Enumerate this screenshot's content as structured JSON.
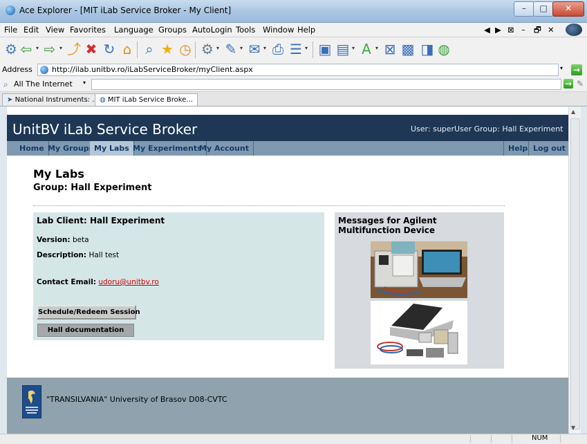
{
  "window": {
    "title": "Ace Explorer - [MIT iLab Service Broker - My Client]",
    "min_symbol": "–",
    "max_symbol": "□",
    "close_symbol": "✕"
  },
  "menu": {
    "items": [
      "File",
      "Edit",
      "View",
      "Favorites",
      "Language",
      "Groups",
      "AutoLogin",
      "Tools",
      "Window",
      "Help"
    ],
    "mdi_controls": [
      "◀",
      "▶",
      "⊠",
      "–",
      "🗗",
      "✕"
    ]
  },
  "address": {
    "label": "Address",
    "url": "http://ilab.unitbv.ro/iLabServiceBroker/myClient.aspx",
    "go_symbol": "→"
  },
  "search": {
    "scope": "All The Internet",
    "dropdown_symbol": "▾"
  },
  "tabs": [
    "National Instruments: ...",
    "MIT iLab Service Broke..."
  ],
  "page": {
    "site_title": "UnitBV iLab Service Broker",
    "user_info": "User: superUser   Group: Hall Experiment",
    "nav": [
      "Home",
      "My Groups",
      "My Labs",
      "My Experiments",
      "My Account"
    ],
    "nav_right": [
      "Help",
      "Log out"
    ],
    "title": "My Labs",
    "group": "Group: Hall Experiment",
    "lab": {
      "heading": "Lab Client: Hall Experiment",
      "version_label": "Version:",
      "version_value": "beta",
      "description_label": "Description:",
      "description_value": "Hall test",
      "contact_label": "Contact Email:",
      "contact_value": "udoru@unitbv.ro",
      "schedule_button": "Schedule/Redeem Session",
      "doc_button": "Hall documentation"
    },
    "messages": {
      "heading": "Messages for Agilent Multifunction Device"
    },
    "footer": {
      "text": "\"TRANSILVANIA\" University of Brasov D08-CVTC"
    }
  },
  "status": {
    "num": "NUM"
  },
  "colors": {
    "header_bg": "#1d3754",
    "nav_bg": "#7f9ab0",
    "lab_box_bg": "#d5e6e7",
    "footer_bg": "#8fa2ad",
    "link": "#cc0000"
  }
}
